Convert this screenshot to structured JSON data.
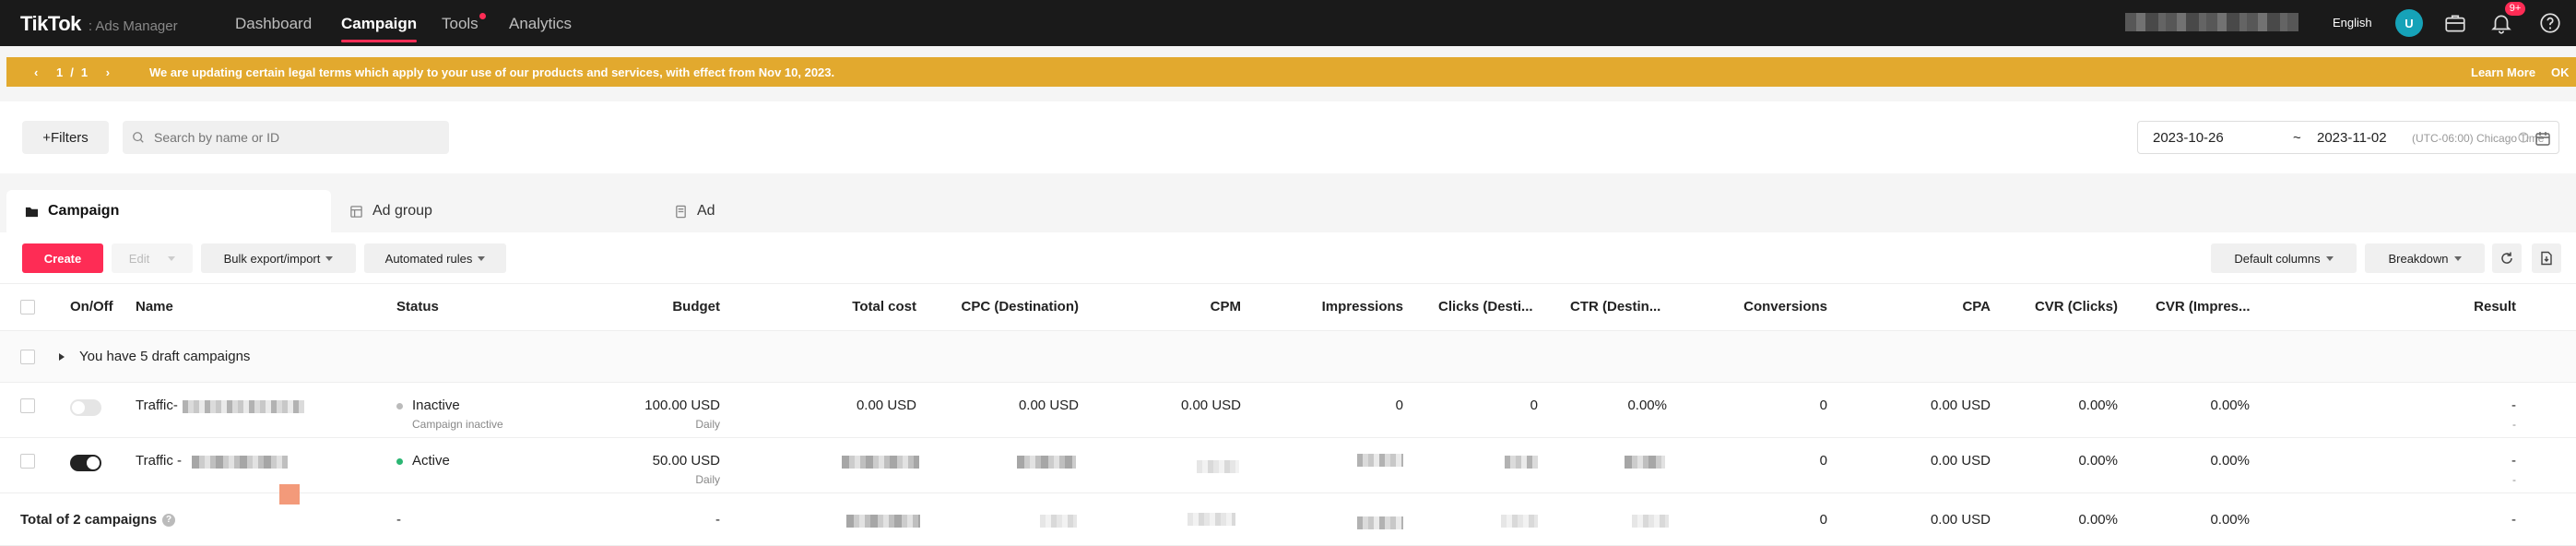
{
  "nav": {
    "brand": "TikTok",
    "brand_suffix": ": Ads Manager",
    "items": [
      {
        "label": "Dashboard"
      },
      {
        "label": "Campaign"
      },
      {
        "label": "Tools"
      },
      {
        "label": "Analytics"
      }
    ],
    "language": "English",
    "avatar_letter": "U",
    "notification_badge": "9+"
  },
  "announcement": {
    "page_current": "1",
    "page_sep": "/",
    "page_total": "1",
    "message": "We are updating certain legal terms which apply to your use of our products and services, with effect from Nov 10, 2023.",
    "learn_more": "Learn More",
    "ok": "OK"
  },
  "filters": {
    "filters_label": "+Filters",
    "search_placeholder": "Search by name or ID",
    "date_start": "2023-10-26",
    "date_sep": "~",
    "date_end": "2023-11-02",
    "timezone": "(UTC-06:00) Chicago Time"
  },
  "tabs": [
    {
      "label": "Campaign"
    },
    {
      "label": "Ad group"
    },
    {
      "label": "Ad"
    }
  ],
  "toolbar": {
    "create": "Create",
    "edit": "Edit",
    "bulk": "Bulk export/import",
    "automated": "Automated rules",
    "default_columns": "Default columns",
    "breakdown": "Breakdown"
  },
  "table": {
    "headers": {
      "onoff": "On/Off",
      "name": "Name",
      "status": "Status",
      "budget": "Budget",
      "total_cost": "Total cost",
      "cpc": "CPC (Destination)",
      "cpm": "CPM",
      "impressions": "Impressions",
      "clicks": "Clicks (Desti...",
      "ctr": "CTR (Destin...",
      "conversions": "Conversions",
      "cpa": "CPA",
      "cvr_clicks": "CVR (Clicks)",
      "cvr_impr": "CVR (Impres...",
      "result": "Result"
    },
    "draft_row": "You have 5 draft campaigns",
    "rows": [
      {
        "name": "Traffic-",
        "status": "Inactive",
        "status_sub": "Campaign inactive",
        "status_color": "#bbbbbb",
        "budget": "100.00 USD",
        "budget_sub": "Daily",
        "total_cost": "0.00 USD",
        "cpc": "0.00 USD",
        "cpm": "0.00 USD",
        "impressions": "0",
        "clicks": "0",
        "ctr": "0.00%",
        "conversions": "0",
        "cpa": "0.00 USD",
        "cvr_clicks": "0.00%",
        "cvr_impr": "0.00%",
        "result": "-",
        "result_sub": "-"
      },
      {
        "name": "Traffic -",
        "status": "Active",
        "status_color": "#2bb673",
        "budget": "50.00 USD",
        "budget_sub": "Daily",
        "conversions": "0",
        "cpa": "0.00 USD",
        "cvr_clicks": "0.00%",
        "cvr_impr": "0.00%",
        "result": "-",
        "result_sub": "-"
      }
    ],
    "total": {
      "label": "Total of 2 campaigns",
      "status": "-",
      "budget": "-",
      "conversions": "0",
      "cpa": "0.00 USD",
      "cvr_clicks": "0.00%",
      "cvr_impr": "0.00%",
      "result": "-"
    }
  },
  "colors": {
    "accent": "#fe2c55",
    "banner": "#e2a92e",
    "nav_bg": "#1a1a1a"
  }
}
